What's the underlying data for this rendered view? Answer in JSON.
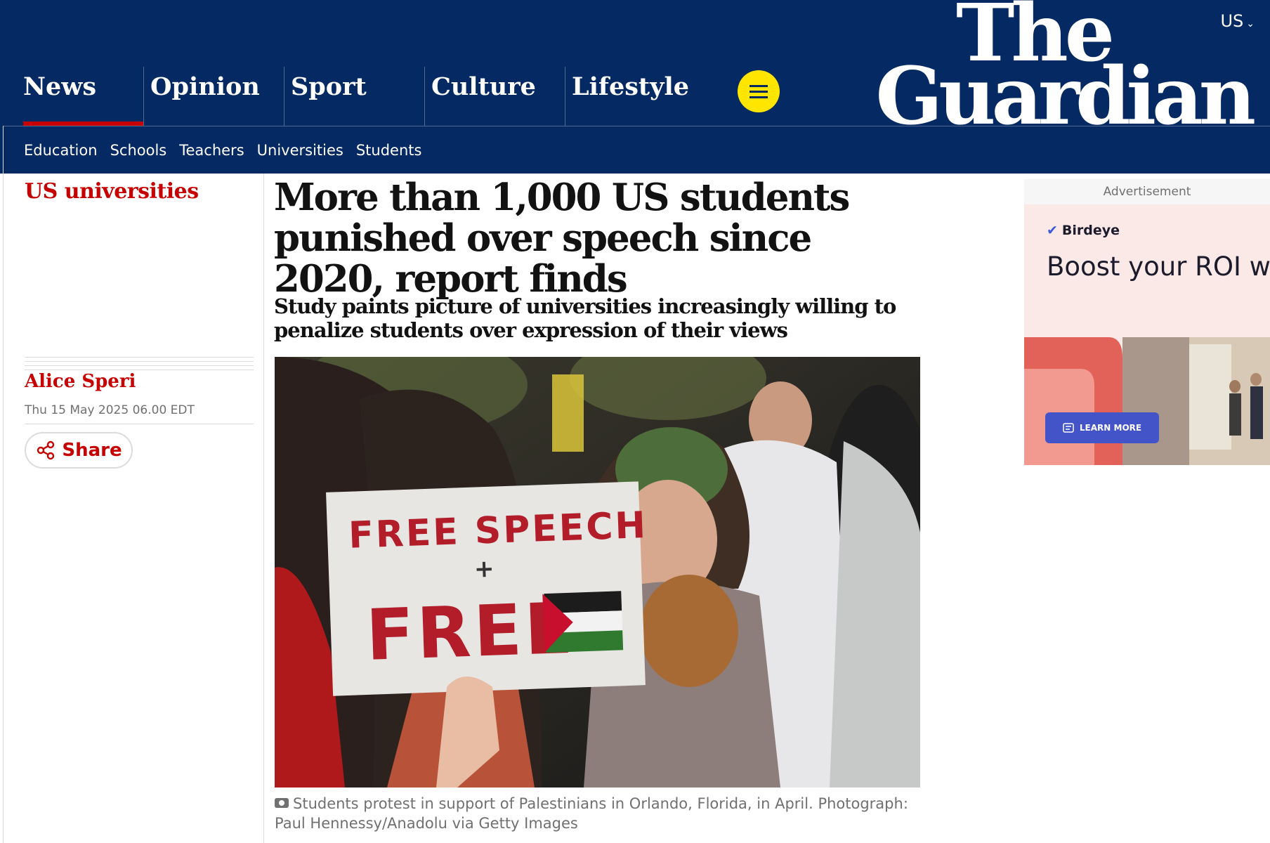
{
  "edition": {
    "label": "US"
  },
  "logo": {
    "line1": "The",
    "line2": "Guardian"
  },
  "pillars": [
    {
      "label": "News",
      "active": true
    },
    {
      "label": "Opinion"
    },
    {
      "label": "Sport"
    },
    {
      "label": "Culture"
    },
    {
      "label": "Lifestyle"
    }
  ],
  "subnav": [
    "Education",
    "Schools",
    "Teachers",
    "Universities",
    "Students"
  ],
  "colors": {
    "brand": "#052962",
    "accent": "#c70000",
    "menu_button": "#ffe500"
  },
  "article": {
    "kicker": "US universities",
    "headline": "More than 1,000 US students punished over speech since 2020, report finds",
    "standfirst": "Study paints picture of universities increasingly willing to penalize students over expression of their views",
    "author": "Alice Speri",
    "date": "Thu 15 May 2025 06.00 EDT",
    "share_label": "Share",
    "image": {
      "sign_line1": "FREE SPEECH",
      "sign_line2": "+",
      "sign_line3": "FREE"
    },
    "caption": "Students protest in support of Palestinians in Orlando, Florida, in April. Photograph: Paul Hennessy/Anadolu via Getty Images"
  },
  "ad": {
    "label": "Advertisement",
    "brand": "Birdeye",
    "headline": "Boost your ROI with better listings online",
    "cta": "LEARN MORE"
  },
  "icons": {
    "edition": "chevron-down-icon",
    "menu": "hamburger-menu-icon",
    "share": "share-icon",
    "caption": "camera-icon",
    "ad_brand": "birdeye-logo-icon",
    "ad_cta": "listing-icon"
  }
}
